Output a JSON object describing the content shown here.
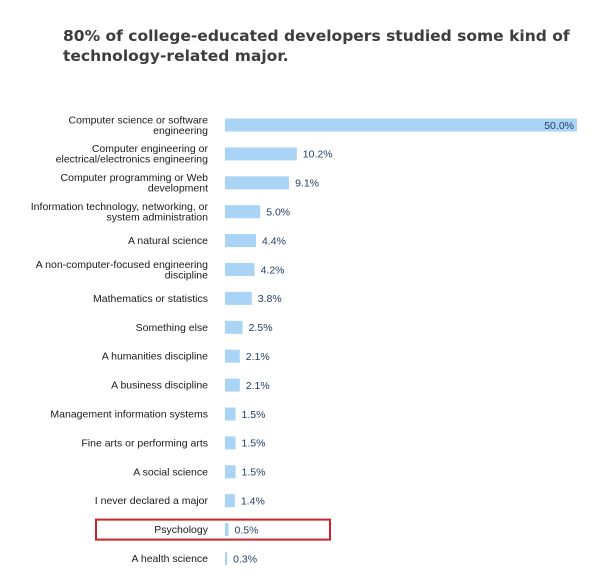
{
  "title": "80% of college-educated developers studied some kind of technology-related major.",
  "chart_data": {
    "type": "bar",
    "orientation": "horizontal",
    "categories": [
      [
        "Computer science or software",
        "engineering"
      ],
      [
        "Computer engineering or",
        "electrical/electronics engineering"
      ],
      [
        "Computer programming or Web",
        "development"
      ],
      [
        "Information technology, networking, or",
        "system administration"
      ],
      [
        "A natural science"
      ],
      [
        "A non-computer-focused engineering",
        "discipline"
      ],
      [
        "Mathematics or statistics"
      ],
      [
        "Something else"
      ],
      [
        "A humanities discipline"
      ],
      [
        "A business discipline"
      ],
      [
        "Management information systems"
      ],
      [
        "Fine arts or performing arts"
      ],
      [
        "A social science"
      ],
      [
        "I never declared a major"
      ],
      [
        "Psychology"
      ],
      [
        "A health science"
      ]
    ],
    "values": [
      50.0,
      10.2,
      9.1,
      5.0,
      4.4,
      4.2,
      3.8,
      2.5,
      2.1,
      2.1,
      1.5,
      1.5,
      1.5,
      1.4,
      0.5,
      0.3
    ],
    "value_labels": [
      "50.0%",
      "10.2%",
      "9.1%",
      "5.0%",
      "4.4%",
      "4.2%",
      "3.8%",
      "2.5%",
      "2.1%",
      "2.1%",
      "1.5%",
      "1.5%",
      "1.5%",
      "1.4%",
      "0.5%",
      "0.3%"
    ],
    "xlim": [
      0,
      50
    ],
    "grid": false,
    "highlighted_category": "Psychology",
    "colors": {
      "bar": "#a9d4f6",
      "highlight_border": "#cc2229",
      "value_text": "#1f3f66"
    }
  }
}
